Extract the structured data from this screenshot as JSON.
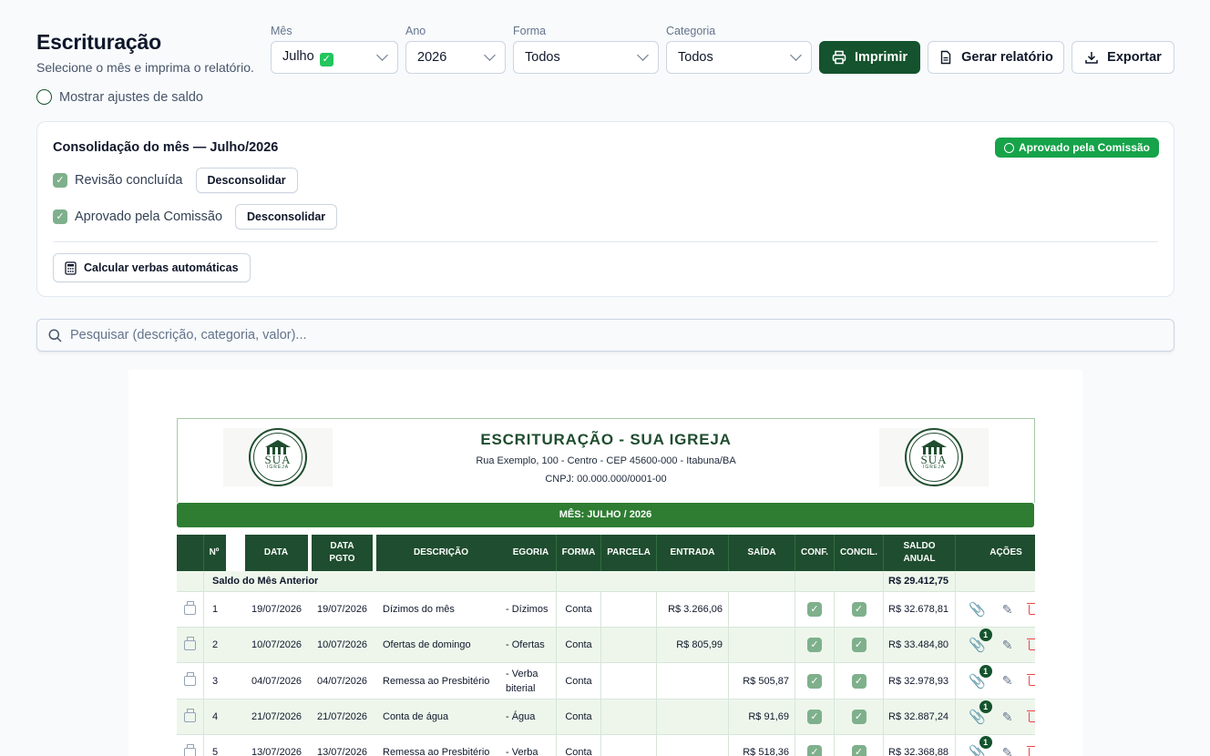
{
  "page": {
    "title": "Escrituração",
    "subtitle": "Selecione o mês e imprima o relatório."
  },
  "filters": {
    "month": {
      "label": "Mês",
      "value": "Julho",
      "check": "✓"
    },
    "year": {
      "label": "Ano",
      "value": "2026"
    },
    "form": {
      "label": "Forma",
      "value": "Todos"
    },
    "category": {
      "label": "Categoria",
      "value": "Todos"
    }
  },
  "actions": {
    "print": "Imprimir",
    "report": "Gerar relatório",
    "export": "Exportar"
  },
  "toggle": {
    "label": "Mostrar ajustes de saldo"
  },
  "consolidation": {
    "title": "Consolidação do mês — Julho/2026",
    "badge": "Aprovado pela Comissão",
    "review_label": "Revisão concluída",
    "approved_label": "Aprovado pela Comissão",
    "unconsolidate": "Desconsolidar",
    "calc_button": "Calcular verbas automáticas"
  },
  "search": {
    "placeholder": "Pesquisar (descrição, categoria, valor)..."
  },
  "report": {
    "title": "ESCRITURAÇÃO - SUA IGREJA",
    "address": "Rua Exemplo, 100 - Centro - CEP 45600-000 - Itabuna/BA",
    "cnpj": "CNPJ: 00.000.000/0001-00",
    "month_banner": "MÊS: JULHO / 2026",
    "logo_text": "SUA",
    "logo_sub": "IGREJA",
    "columns": {
      "num": "Nº",
      "date": "DATA",
      "date_pay_1": "DATA",
      "date_pay_2": "PGTO",
      "description": "DESCRIÇÃO",
      "category": "EGORIA",
      "form": "FORMA",
      "parcel": "PARCELA",
      "in": "ENTRADA",
      "out": "SAÍDA",
      "conf": "CONF.",
      "concil": "CONCIL.",
      "balance_1": "SALDO",
      "balance_2": "ANUAL",
      "actions": "AÇÕES"
    },
    "previous": {
      "label": "Saldo do Mês Anterior",
      "balance": "R$ 29.412,75"
    },
    "rows": [
      {
        "num": "1",
        "date": "19/07/2026",
        "pay": "19/07/2026",
        "desc": "Dízimos do mês",
        "cat1": "- Dízimos",
        "cat2": "",
        "form": "Conta",
        "parcel": "",
        "in": "R$ 3.266,06",
        "out": "",
        "balance": "R$ 32.678,81",
        "attachments": ""
      },
      {
        "num": "2",
        "date": "10/07/2026",
        "pay": "10/07/2026",
        "desc": "Ofertas de domingo",
        "cat1": "- Ofertas",
        "cat2": "",
        "form": "Conta",
        "parcel": "",
        "in": "R$ 805,99",
        "out": "",
        "balance": "R$ 33.484,80",
        "attachments": "1"
      },
      {
        "num": "3",
        "date": "04/07/2026",
        "pay": "04/07/2026",
        "desc": "Remessa ao Presbitério",
        "cat1": "- Verba",
        "cat2": "biterial",
        "form": "Conta",
        "parcel": "",
        "in": "",
        "out": "R$ 505,87",
        "balance": "R$ 32.978,93",
        "attachments": "1"
      },
      {
        "num": "4",
        "date": "21/07/2026",
        "pay": "21/07/2026",
        "desc": "Conta de água",
        "cat1": "- Água",
        "cat2": "",
        "form": "Conta",
        "parcel": "",
        "in": "",
        "out": "R$ 91,69",
        "balance": "R$ 32.887,24",
        "attachments": "1"
      },
      {
        "num": "5",
        "date": "13/07/2026",
        "pay": "13/07/2026",
        "desc": "Remessa ao Presbitério",
        "cat1": "- Verba",
        "cat2": "",
        "form": "Conta",
        "parcel": "",
        "in": "",
        "out": "R$ 518,36",
        "balance": "R$ 32.368,88",
        "attachments": "1"
      }
    ]
  },
  "colors": {
    "primary": "#14532d",
    "banner": "#2e7d32",
    "header": "#1f4d2f",
    "ok": "#16a34a"
  }
}
